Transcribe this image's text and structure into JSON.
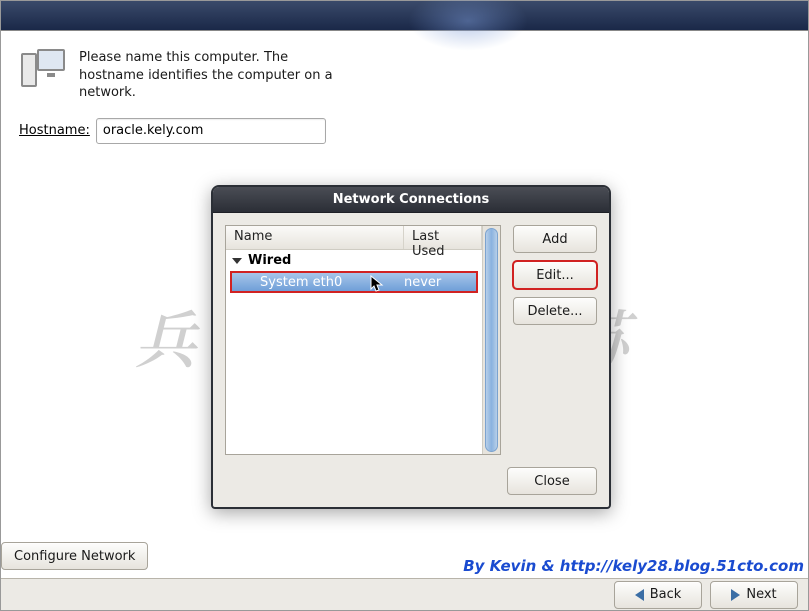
{
  "intro_text": "Please name this computer.  The hostname identifies the computer on a network.",
  "hostname": {
    "label": "Hostname:",
    "value": "oracle.kely.com"
  },
  "configure_button": "Configure Network",
  "nav": {
    "back": "Back",
    "next": "Next"
  },
  "dialog": {
    "title": "Network Connections",
    "columns": {
      "name": "Name",
      "last_used": "Last Used"
    },
    "group": "Wired",
    "rows": [
      {
        "name": "System eth0",
        "last_used": "never",
        "selected": true
      }
    ],
    "buttons": {
      "add": "Add",
      "edit": "Edit...",
      "delete": "Delete...",
      "close": "Close"
    }
  },
  "watermark": "兵马俑复苏",
  "attribution": "By Kevin & http://kely28.blog.51cto.com"
}
